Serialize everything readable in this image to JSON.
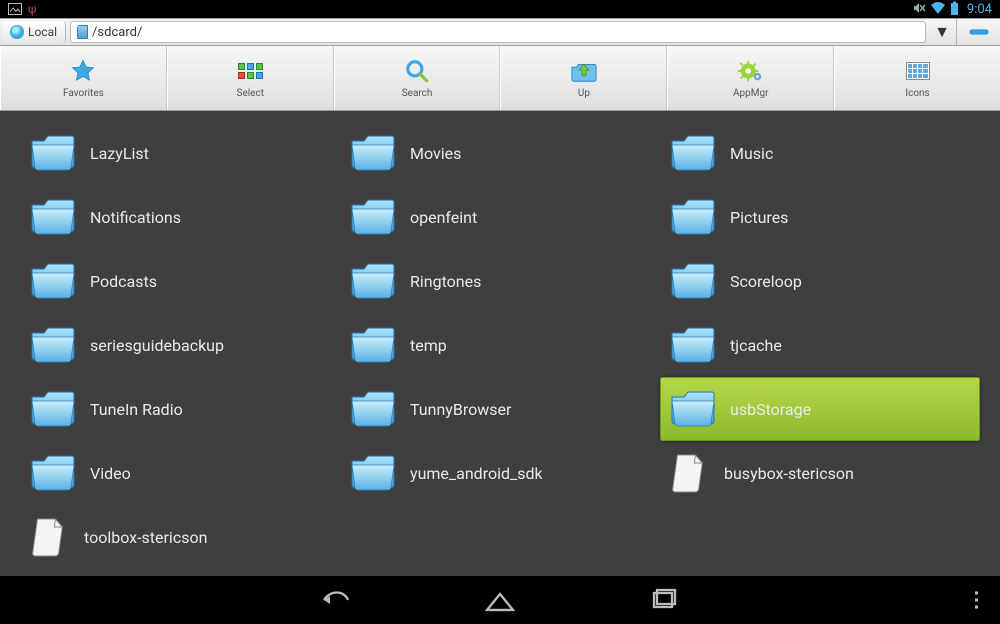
{
  "status": {
    "time": "9:04"
  },
  "address": {
    "local_label": "Local",
    "path": "/sdcard/"
  },
  "toolbar": {
    "favorites": "Favorites",
    "select": "Select",
    "search": "Search",
    "up": "Up",
    "appmgr": "AppMgr",
    "icons": "Icons"
  },
  "files": [
    {
      "name": "LazyList",
      "type": "folder",
      "selected": false
    },
    {
      "name": "Movies",
      "type": "folder",
      "selected": false
    },
    {
      "name": "Music",
      "type": "folder",
      "selected": false
    },
    {
      "name": "Notifications",
      "type": "folder",
      "selected": false
    },
    {
      "name": "openfeint",
      "type": "folder",
      "selected": false
    },
    {
      "name": "Pictures",
      "type": "folder",
      "selected": false
    },
    {
      "name": "Podcasts",
      "type": "folder",
      "selected": false
    },
    {
      "name": "Ringtones",
      "type": "folder",
      "selected": false
    },
    {
      "name": "Scoreloop",
      "type": "folder",
      "selected": false
    },
    {
      "name": "seriesguidebackup",
      "type": "folder",
      "selected": false
    },
    {
      "name": "temp",
      "type": "folder",
      "selected": false
    },
    {
      "name": "tjcache",
      "type": "folder",
      "selected": false
    },
    {
      "name": "TuneIn Radio",
      "type": "folder",
      "selected": false
    },
    {
      "name": "TunnyBrowser",
      "type": "folder",
      "selected": false
    },
    {
      "name": "usbStorage",
      "type": "folder",
      "selected": true
    },
    {
      "name": "Video",
      "type": "folder",
      "selected": false
    },
    {
      "name": "yume_android_sdk",
      "type": "folder",
      "selected": false
    },
    {
      "name": "busybox-stericson",
      "type": "file",
      "selected": false
    },
    {
      "name": "toolbox-stericson",
      "type": "file",
      "selected": false
    }
  ]
}
